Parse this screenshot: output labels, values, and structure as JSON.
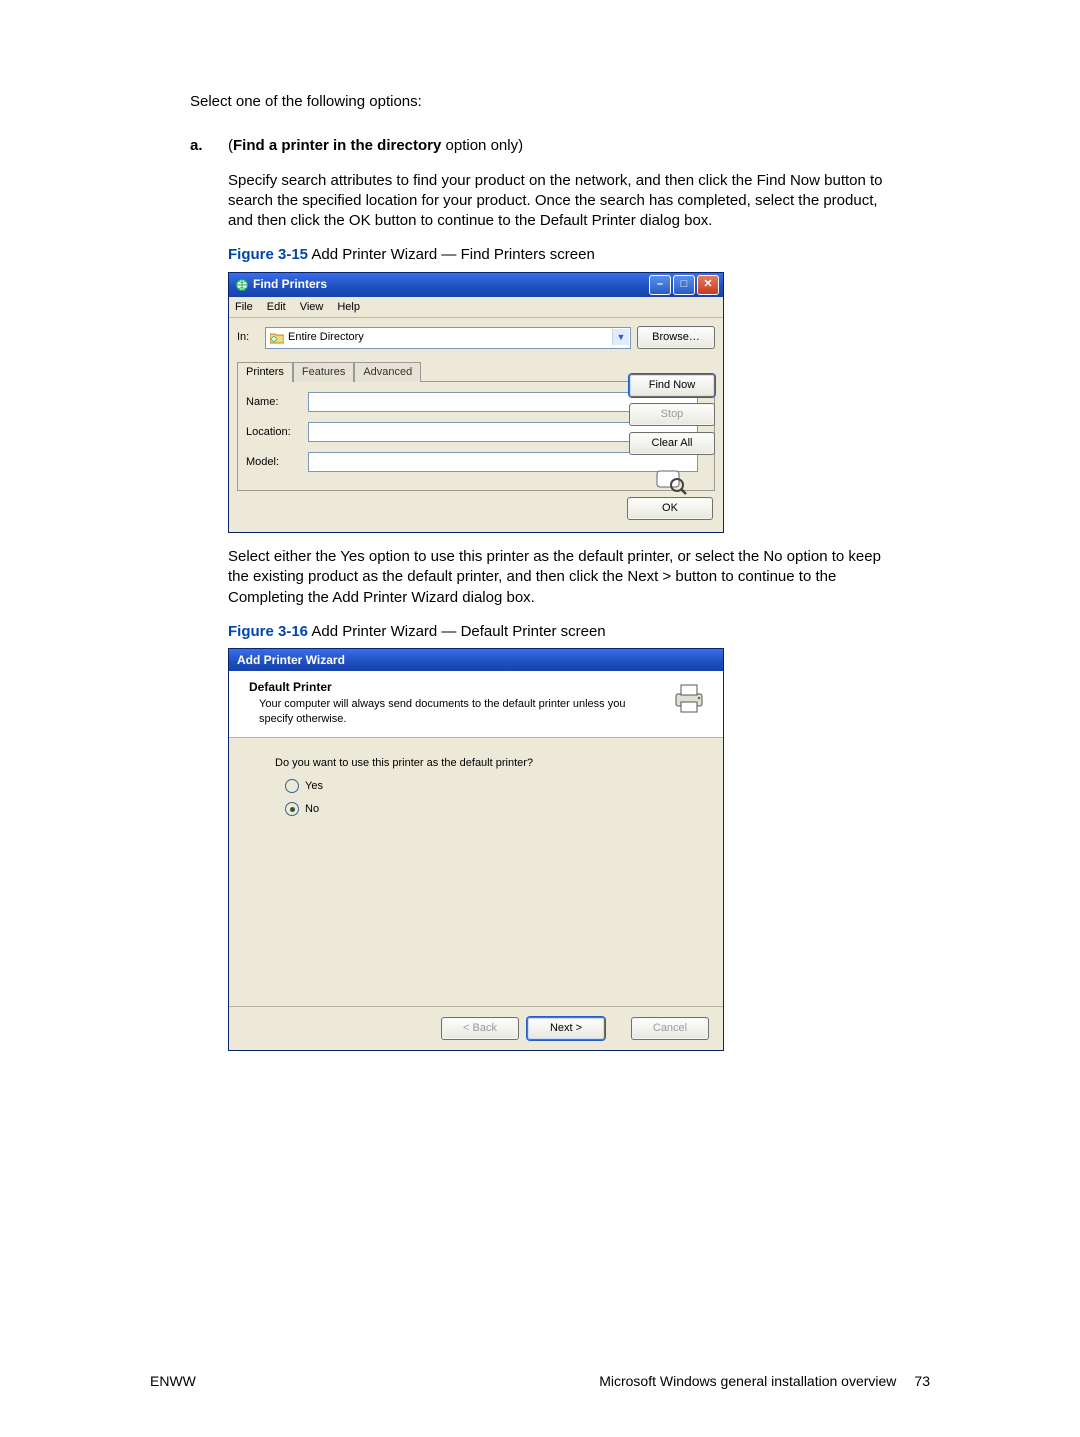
{
  "intro": "Select one of the following options:",
  "step_a": {
    "marker": "a.",
    "heading_pre": "(",
    "heading_bold": "Find a printer in the directory",
    "heading_post": " option only)",
    "para": "Specify search attributes to find your product on the network, and then click the Find Now button to search the specified location for your product. Once the search has completed, select the product, and then click the OK button to continue to the Default Printer dialog box."
  },
  "figure15": {
    "label": "Figure 3-15",
    "caption": "  Add Printer Wizard — Find Printers screen"
  },
  "findPrinters": {
    "title": "Find Printers",
    "menu": [
      "File",
      "Edit",
      "View",
      "Help"
    ],
    "in_label": "In:",
    "in_value": "Entire Directory",
    "browse": "Browse…",
    "tabs": [
      "Printers",
      "Features",
      "Advanced"
    ],
    "form": {
      "name_label": "Name:",
      "name_value": "",
      "location_label": "Location:",
      "location_value": "",
      "model_label": "Model:",
      "model_value": ""
    },
    "side_buttons": {
      "find_now": "Find Now",
      "stop": "Stop",
      "clear_all": "Clear All"
    },
    "ok": "OK"
  },
  "after15": "Select either the Yes option to use this printer as the default printer, or select the No option to keep the existing product as the default printer, and then click the Next > button to continue to the Completing the Add Printer Wizard dialog box.",
  "after15_plain": "Select either the Yes option to use this printer as the default printer, or select the No option to keep the existing product as the default printer, and then click the Next > button to continue to the Completing the Add Printer Wizard dialog box.",
  "figure16": {
    "label": "Figure 3-16",
    "caption": "  Add Printer Wizard — Default Printer screen"
  },
  "wizard": {
    "title": "Add Printer Wizard",
    "header_title": "Default Printer",
    "header_desc": "Your computer will always send documents to the default printer unless you specify otherwise.",
    "question": "Do you want to use this printer as the default printer?",
    "yes": "Yes",
    "no": "No",
    "selected": "no",
    "back": "< Back",
    "next": "Next >",
    "cancel": "Cancel"
  },
  "footer": {
    "left": "ENWW",
    "right": "Microsoft Windows general installation overview",
    "page": "73"
  }
}
